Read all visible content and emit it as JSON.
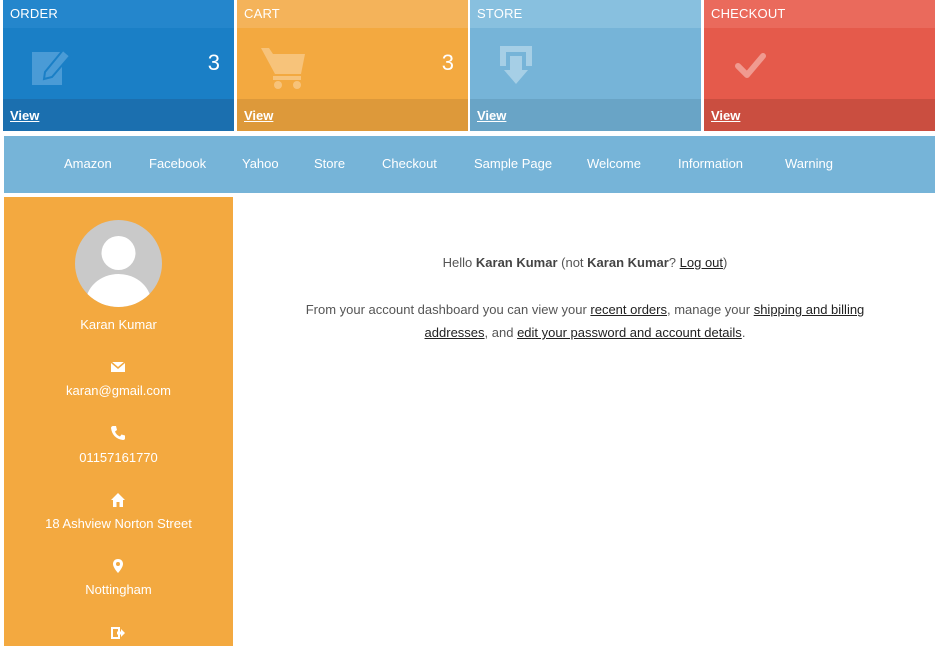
{
  "tiles": {
    "order": {
      "title": "ORDER",
      "count": "3",
      "link": "View",
      "icon": "edit-icon"
    },
    "cart": {
      "title": "CART",
      "count": "3",
      "link": "View",
      "icon": "cart-icon"
    },
    "store": {
      "title": "STORE",
      "link": "View",
      "icon": "store-download-icon"
    },
    "checkout": {
      "title": "CHECKOUT",
      "link": "View",
      "icon": "checkmark-icon"
    }
  },
  "nav": [
    "Amazon",
    "Facebook",
    "Yahoo",
    "Store",
    "Checkout",
    "Sample Page",
    "Welcome",
    "Information",
    "Warning"
  ],
  "sidebar": {
    "name": "Karan Kumar",
    "email": "karan@gmail.com",
    "phone": "01157161770",
    "address": "18 Ashview Norton Street",
    "city": "Nottingham"
  },
  "content": {
    "hello_prefix": "Hello ",
    "user_name": "Karan Kumar",
    "not_prefix": " (not ",
    "not_name": "Karan Kumar",
    "not_q": "? ",
    "logout": "Log out",
    "close_paren": ")",
    "dash_text_1": "From your account dashboard you can view your ",
    "recent_orders": "recent orders",
    "dash_text_2": ", manage your ",
    "shipping_1": "shipping and billing",
    "shipping_2": "addresses",
    "dash_text_3": ", and ",
    "edit_details": "edit your password and account details",
    "dash_text_4": "."
  },
  "colors": {
    "order": "#1a7fc6",
    "cart": "#f3a940",
    "store": "#76b4d8",
    "checkout": "#e55a4b"
  }
}
